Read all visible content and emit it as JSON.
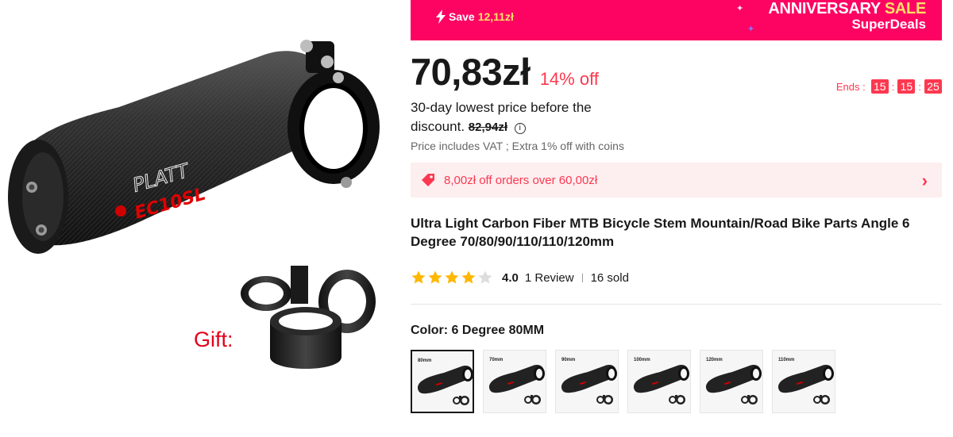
{
  "product_image": {
    "stem_brand": "PLATT",
    "stem_model": "EC10SL",
    "gift_label": "Gift:"
  },
  "banner": {
    "save_label": "Save",
    "save_amount": "12,11zł",
    "anniversary_word1": "ANNIVERSARY",
    "anniversary_word2": "SALE",
    "superdeals": "SuperDeals",
    "bg_color": "#fd0463"
  },
  "price": {
    "current": "70,83zł",
    "discount": "14% off",
    "lowest_text": "30-day lowest price before the discount.",
    "lowest_value": "82,94zł",
    "vat_note": "Price includes VAT ; Extra 1% off with coins"
  },
  "countdown": {
    "ends_label": "Ends :",
    "hours": "15",
    "minutes": "15",
    "seconds": "25",
    "sep": ":"
  },
  "coupon": {
    "text": "8,00zł off orders over 60,00zł",
    "icon": "tag-icon"
  },
  "product": {
    "title": "Ultra Light Carbon Fiber MTB Bicycle Stem Mountain/Road Bike Parts Angle 6 Degree 70/80/90/110/110/120mm"
  },
  "rating": {
    "value": "4.0",
    "stars": 4,
    "max_stars": 5,
    "reviews": "1 Review",
    "sold": "16 sold"
  },
  "color": {
    "label": "Color: 6 Degree 80MM",
    "options": [
      {
        "label": "80mm",
        "selected": true
      },
      {
        "label": "70mm",
        "selected": false
      },
      {
        "label": "90mm",
        "selected": false
      },
      {
        "label": "100mm",
        "selected": false
      },
      {
        "label": "120mm",
        "selected": false
      },
      {
        "label": "110mm",
        "selected": false
      }
    ]
  },
  "colors": {
    "accent": "#fd384f",
    "banner_pink": "#fd0463",
    "star": "#ffb700",
    "star_empty": "#dddddd"
  }
}
